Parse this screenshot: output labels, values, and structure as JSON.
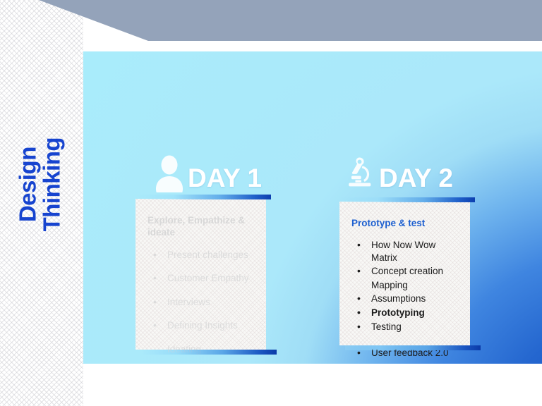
{
  "slide": {
    "sidebar": {
      "title_line1": "Design",
      "title_line2": "Thinking",
      "title_color": "#1744cf"
    },
    "banner": {
      "color": "#94a3ba"
    },
    "panel": {
      "gradient_from": "#a9ecfb",
      "gradient_to": "#1552c4"
    },
    "days": [
      {
        "icon": "person-icon",
        "label": "DAY 1",
        "state": "muted",
        "title": "Explore, Empathize & ideate",
        "title_color": "#d8d8d8",
        "items": [
          {
            "text": "Present challenges",
            "bullet": true,
            "bold": false,
            "gap": false
          },
          {
            "text": "Customer Empathy",
            "bullet": true,
            "bold": false,
            "gap": false
          },
          {
            "text": "Interviews",
            "bullet": true,
            "bold": false,
            "gap": false
          },
          {
            "text": "Defining Insights",
            "bullet": true,
            "bold": false,
            "gap": false
          },
          {
            "text": "Ideating",
            "bullet": false,
            "bold": false,
            "gap": false
          }
        ]
      },
      {
        "icon": "microscope-icon",
        "label": "DAY 2",
        "state": "active",
        "title": "Prototype & test",
        "title_color": "#1c5fd0",
        "items": [
          {
            "text": "How Now Wow Matrix",
            "bullet": true,
            "bold": false,
            "gap": false
          },
          {
            "text": "Concept creation",
            "bullet": true,
            "bold": false,
            "gap": false
          },
          {
            "text": "Mapping",
            "bullet": false,
            "bold": false,
            "gap": false
          },
          {
            "text": "Assumptions",
            "bullet": true,
            "bold": false,
            "gap": false
          },
          {
            "text": "Prototyping",
            "bullet": true,
            "bold": true,
            "gap": false
          },
          {
            "text": "Testing",
            "bullet": true,
            "bold": false,
            "gap": false
          },
          {
            "text": "User feedback 2.0",
            "bullet": true,
            "bold": false,
            "gap": true
          }
        ]
      }
    ]
  }
}
